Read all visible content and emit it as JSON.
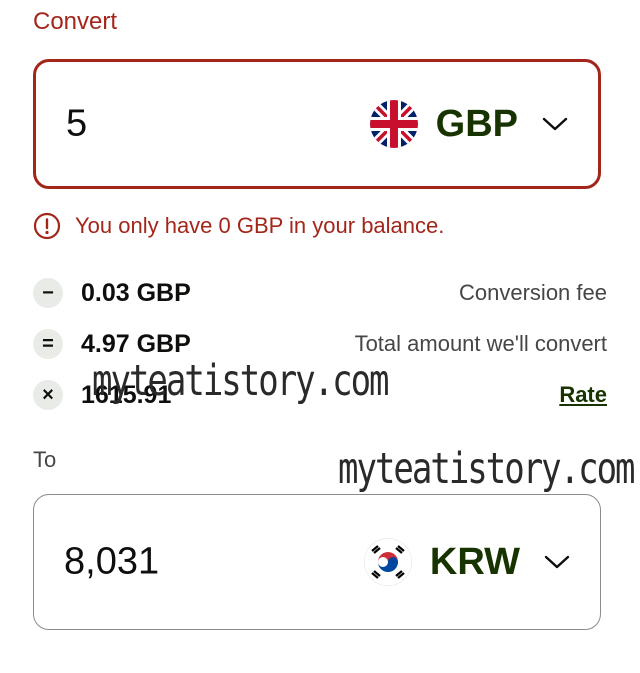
{
  "convert": {
    "label": "Convert",
    "amount": "5",
    "currency_code": "GBP",
    "flag_icon": "uk-flag-icon",
    "accent_color": "#a3261b"
  },
  "error": {
    "message": "You only have 0 GBP in your balance.",
    "icon": "alert-circle-icon"
  },
  "breakdown": {
    "fee": {
      "symbol": "−",
      "value": "0.03 GBP",
      "label": "Conversion fee"
    },
    "total": {
      "symbol": "=",
      "value": "4.97 GBP",
      "label": "Total amount we'll convert"
    },
    "rate": {
      "symbol": "×",
      "value": "1615.91",
      "link": "Rate"
    }
  },
  "to": {
    "label": "To",
    "amount": "8,031",
    "currency_code": "KRW",
    "flag_icon": "south-korea-flag-icon"
  },
  "watermark": {
    "text_1": "myteatistory.com",
    "text_2": "myteatistory.com"
  },
  "colors": {
    "brand_green": "#163300",
    "error_red": "#a3261b"
  }
}
